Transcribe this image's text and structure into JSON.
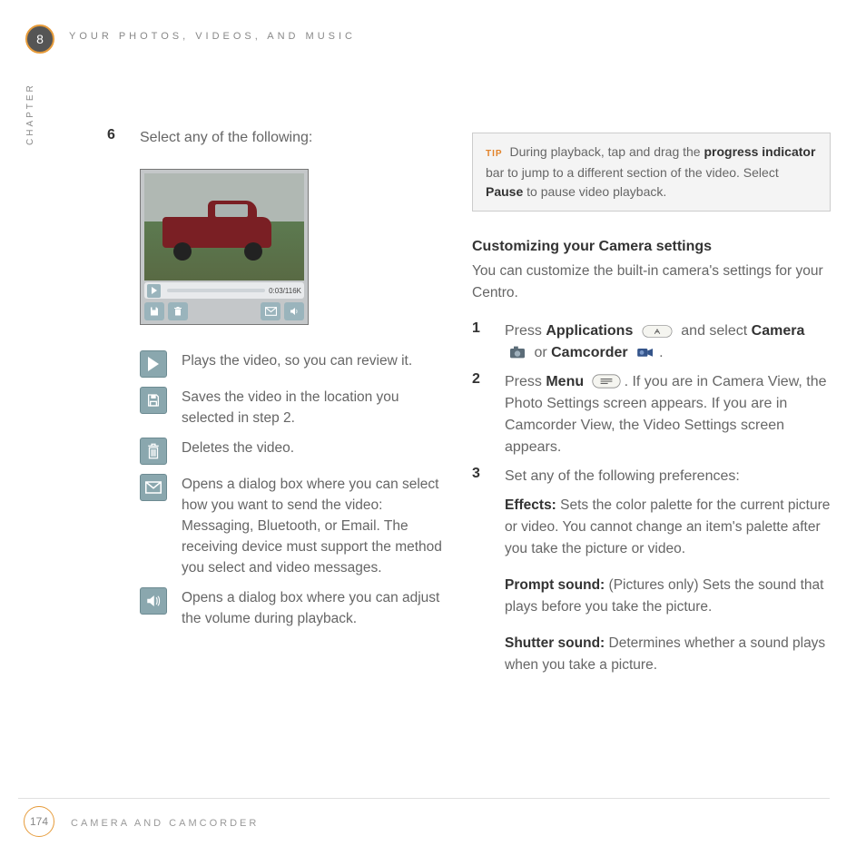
{
  "chapter_number": "8",
  "chapter_label": "CHAPTER",
  "header_title": "YOUR PHOTOS, VIDEOS, AND MUSIC",
  "step6": {
    "num": "6",
    "text": "Select any of the following:"
  },
  "screenshot": {
    "progress_label": "0:03/116K"
  },
  "icon_list": {
    "play": "Plays the video, so you can review it.",
    "save": "Saves the video in the location you selected in step 2.",
    "delete_": "Deletes the video.",
    "send": "Opens a dialog box where you can select how you want to send the video: Messaging, Bluetooth, or Email. The receiving device must support the method you select and video messages.",
    "volume": "Opens a dialog box where you can adjust the volume during playback."
  },
  "tip": {
    "label": "TIP",
    "t1": "During playback, tap and drag the ",
    "b1": "progress indicator",
    "t2": " bar to jump to a different section of the video. Select ",
    "b2": "Pause",
    "t3": " to pause video playback."
  },
  "right": {
    "heading": "Customizing your Camera settings",
    "intro": "You can customize the built-in camera's settings for your Centro.",
    "s1_num": "1",
    "s1_a": "Press ",
    "s1_b": "Applications",
    "s1_c": " and select ",
    "s1_d": "Camera",
    "s1_e": " or ",
    "s1_f": "Camcorder",
    "s1_g": ".",
    "s2_num": "2",
    "s2_a": "Press ",
    "s2_b": "Menu",
    "s2_c": ". If you are in Camera View, the Photo Settings screen appears. If you are in Camcorder View, the Video Settings screen appears.",
    "s3_num": "3",
    "s3_text": "Set any of the following preferences:",
    "effects_label": "Effects: ",
    "effects": "Sets the color palette for the current picture or video. You cannot change an item's palette after you take the picture or video.",
    "prompt_label": "Prompt sound: ",
    "prompt": "(Pictures only) Sets the sound that plays before you take the picture.",
    "shutter_label": "Shutter sound: ",
    "shutter": "Determines whether a sound plays when you take a picture."
  },
  "footer": {
    "page": "174",
    "title": "CAMERA AND CAMCORDER"
  }
}
